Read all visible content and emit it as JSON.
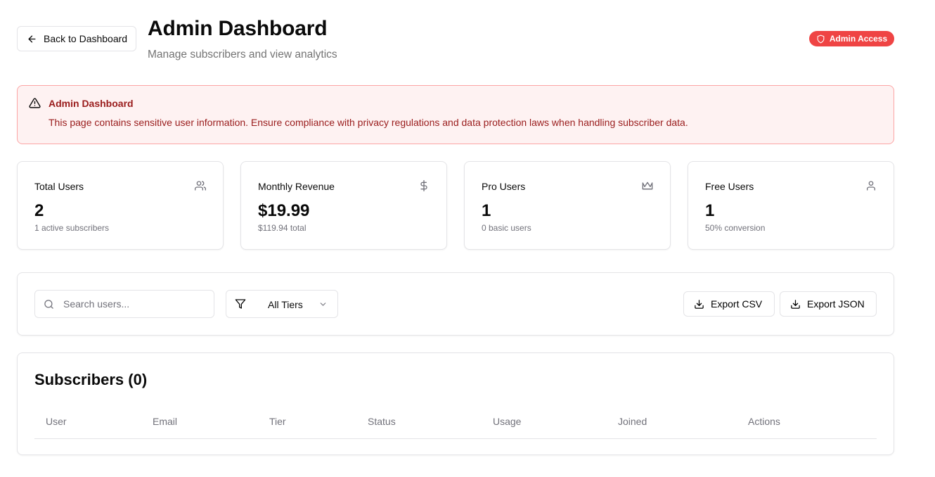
{
  "header": {
    "back_label": "Back to Dashboard",
    "title": "Admin Dashboard",
    "subtitle": "Manage subscribers and view analytics",
    "badge_label": "Admin Access",
    "badge_color": "#ef4444"
  },
  "alert": {
    "title": "Admin Dashboard",
    "message": "This page contains sensitive user information. Ensure compliance with privacy regulations and data protection laws when handling subscriber data.",
    "icon": "alert-triangle-icon"
  },
  "stats": [
    {
      "label": "Total Users",
      "value": "2",
      "sub": "1 active subscribers",
      "icon": "users-icon"
    },
    {
      "label": "Monthly Revenue",
      "value": "$19.99",
      "sub": "$119.94 total",
      "icon": "dollar-icon"
    },
    {
      "label": "Pro Users",
      "value": "1",
      "sub": "0 basic users",
      "icon": "crown-icon"
    },
    {
      "label": "Free Users",
      "value": "1",
      "sub": "50% conversion",
      "icon": "user-icon"
    }
  ],
  "toolbar": {
    "search_placeholder": "Search users...",
    "search_value": "",
    "tier_filter": "All Tiers",
    "export_csv": "Export CSV",
    "export_json": "Export JSON"
  },
  "subscribers": {
    "title": "Subscribers (0)",
    "columns": [
      "User",
      "Email",
      "Tier",
      "Status",
      "Usage",
      "Joined",
      "Actions"
    ],
    "rows": []
  }
}
